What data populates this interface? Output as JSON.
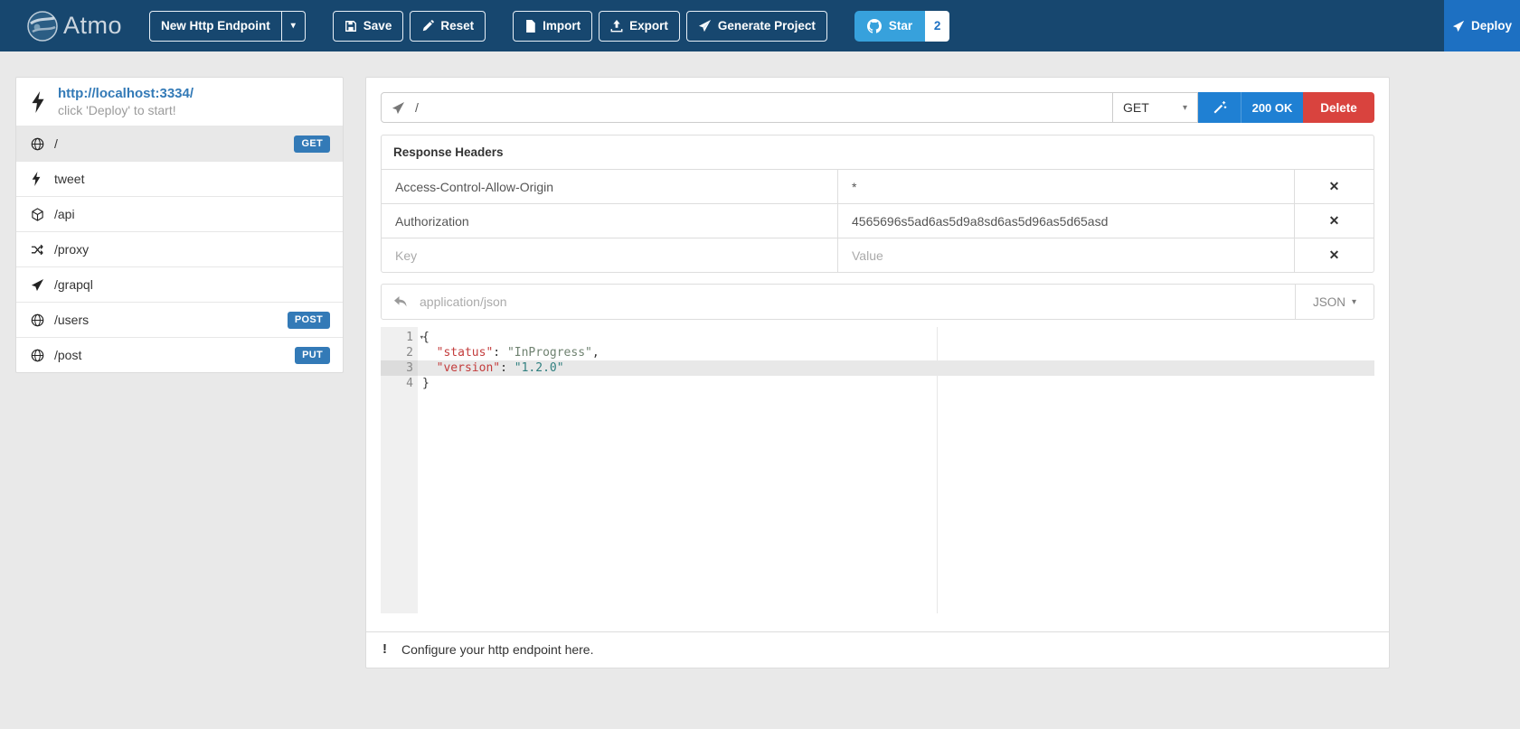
{
  "icons": {
    "caret": "▾",
    "remove": "✕",
    "excl": "!"
  },
  "navbar": {
    "brand": "Atmo",
    "new_endpoint": "New Http Endpoint",
    "save": "Save",
    "reset": "Reset",
    "import": "Import",
    "export": "Export",
    "generate": "Generate Project",
    "star": "Star",
    "star_count": "2",
    "deploy": "Deploy"
  },
  "sidebar": {
    "base_url": "http://localhost:3334/",
    "hint": "click 'Deploy' to start!",
    "endpoints": [
      {
        "label": "/",
        "method": "GET"
      },
      {
        "label": "tweet",
        "method": ""
      },
      {
        "label": "/api",
        "method": ""
      },
      {
        "label": "/proxy",
        "method": ""
      },
      {
        "label": "/grapql",
        "method": ""
      },
      {
        "label": "/users",
        "method": "POST"
      },
      {
        "label": "/post",
        "method": "PUT"
      }
    ]
  },
  "panel": {
    "path_value": "/",
    "method": "GET",
    "status": "200 OK",
    "delete": "Delete",
    "headers_title": "Response Headers",
    "headers": [
      {
        "key": "Access-Control-Allow-Origin",
        "value": "*"
      },
      {
        "key": "Authorization",
        "value": "4565696s5ad6as5d9a8sd6as5d96as5d65asd"
      }
    ],
    "key_placeholder": "Key",
    "value_placeholder": "Value",
    "content_type_placeholder": "application/json",
    "body_format": "JSON",
    "code": {
      "line_numbers": [
        "1",
        "2",
        "3",
        "4"
      ],
      "indent": "  ",
      "l1": "{",
      "l2_key": "\"status\"",
      "colon": ": ",
      "l2_val": "\"InProgress\"",
      "comma": ",",
      "l3_key": "\"version\"",
      "l3_val": "\"1.2.0\"",
      "l4": "}"
    },
    "footer": "Configure your http endpoint here."
  },
  "colors": {
    "navbar": "#17476f",
    "primary": "#337ab7",
    "action_blue": "#1f80d3",
    "star_blue": "#37a1dc",
    "deploy_blue": "#1d70c2",
    "danger": "#d9433e"
  }
}
